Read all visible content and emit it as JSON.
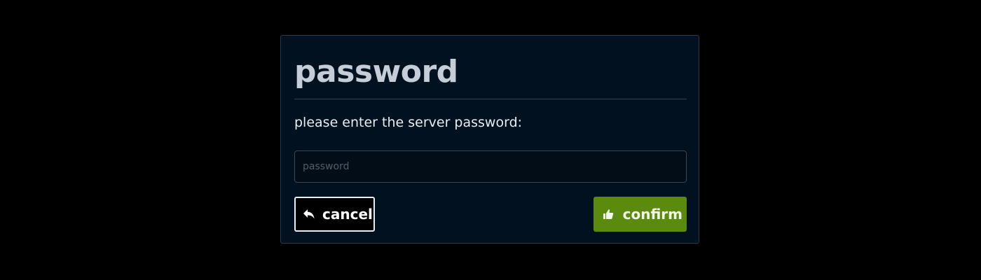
{
  "dialog": {
    "title": "password",
    "prompt": "please enter the server password:",
    "input": {
      "placeholder": "password",
      "value": ""
    },
    "cancel_button": {
      "label": "cancel",
      "icon": "reply-arrow-icon"
    },
    "confirm_button": {
      "label": "confirm",
      "icon": "thumbs-up-icon"
    }
  },
  "colors": {
    "background": "#000000",
    "dialog_bg": "#02111f",
    "title": "#c5ced8",
    "confirm_bg": "#5a8a0e"
  }
}
